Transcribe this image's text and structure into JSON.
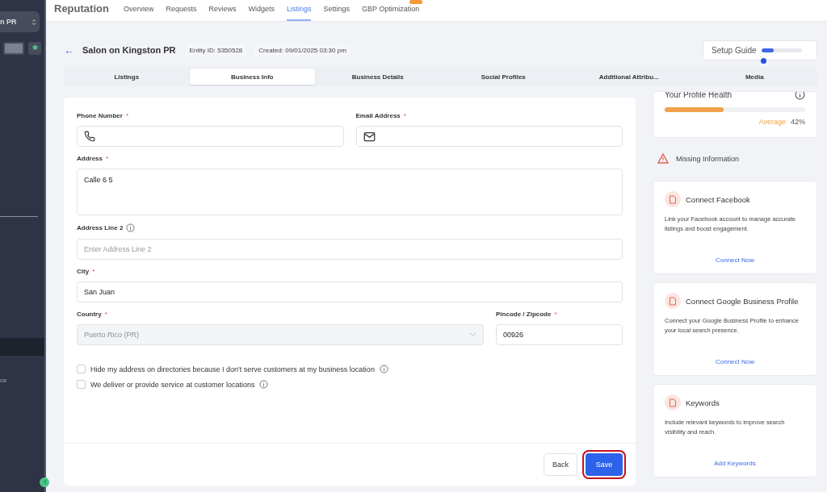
{
  "sidebar": {
    "account_name": "n PR",
    "items": [
      {
        "label": "ce",
        "selected": false
      }
    ]
  },
  "top_nav": {
    "title": "Reputation",
    "tabs": [
      {
        "label": "Overview",
        "selected": false
      },
      {
        "label": "Requests",
        "selected": false
      },
      {
        "label": "Reviews",
        "selected": false
      },
      {
        "label": "Widgets",
        "selected": false
      },
      {
        "label": "Listings",
        "selected": true
      },
      {
        "label": "Settings",
        "selected": false
      },
      {
        "label": "GBP Optimization",
        "selected": false,
        "badge": true
      }
    ]
  },
  "header": {
    "back": "←",
    "title": "Salon on Kingston PR",
    "entity_id": "Entity ID: 5350528",
    "created": "Created: 09/01/2025 03:30 pm",
    "setup_guide": {
      "label": "Setup Guide",
      "level": 0.3
    }
  },
  "sub_tabs": [
    {
      "label": "Listings",
      "selected": false
    },
    {
      "label": "Business Info",
      "selected": true
    },
    {
      "label": "Business Details",
      "selected": false
    },
    {
      "label": "Social Profiles",
      "selected": false
    },
    {
      "label": "Additional Attribu...",
      "selected": false
    },
    {
      "label": "Media",
      "selected": false
    }
  ],
  "form": {
    "phone": {
      "label": "Phone Number",
      "required_mark": "*"
    },
    "email": {
      "label": "Email Address",
      "required_mark": "*"
    },
    "address": {
      "label": "Address",
      "required_mark": "*",
      "value": "Calle 6 5"
    },
    "address2": {
      "label": "Address Line 2",
      "placeholder": "Enter Address Line 2"
    },
    "city": {
      "label": "City",
      "required_mark": "*",
      "value": "San Juan"
    },
    "country": {
      "label": "Country",
      "required_mark": "*",
      "value": "Puerto Rico (PR)",
      "disabled": true
    },
    "zip": {
      "label": "Pincode / Zipcode",
      "required_mark": "*",
      "value": "00926"
    },
    "options": [
      {
        "label": "Hide my address on directories because I don't serve customers at my business location",
        "checked": false
      },
      {
        "label": "We deliver or provide service at customer locations",
        "checked": false
      }
    ],
    "buttons": [
      {
        "label": "Back",
        "kind": "secondary",
        "highlighted": false
      },
      {
        "label": "Save",
        "kind": "primary",
        "highlighted": true
      }
    ]
  },
  "profile_health": {
    "title": "Your Profile Health",
    "level": 0.42,
    "rating": "Average",
    "percent": "42%"
  },
  "missing": {
    "title": "Missing Information",
    "cards": [
      {
        "title": "Connect Facebook",
        "text": "Link your Facebook account to manage accurate listings and boost engagement.",
        "action": "Connect Now"
      },
      {
        "title": "Connect Google Business Profile",
        "text": "Connect your Google Business Profile to enhance your local search presence.",
        "action": "Connect Now"
      },
      {
        "title": "Keywords",
        "text": "Include relevant keywords to improve search visibility and reach.",
        "action": "Add Keywords"
      }
    ]
  }
}
